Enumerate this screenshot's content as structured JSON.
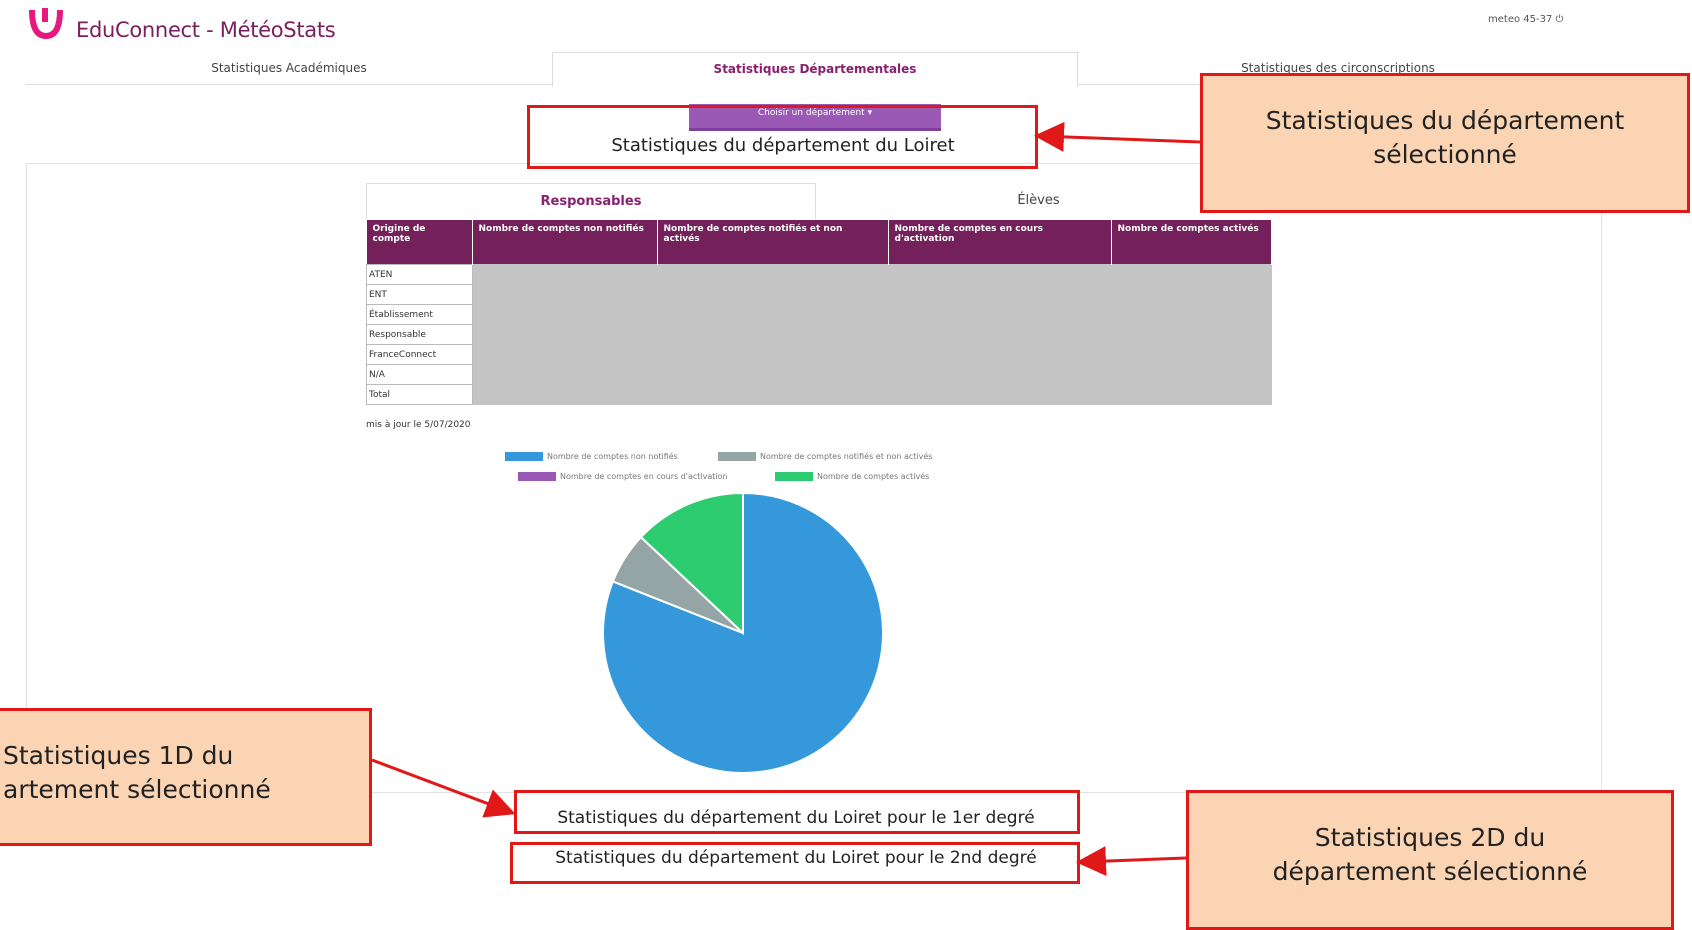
{
  "header": {
    "logo_icon": "educonnect-logo-icon",
    "app_title": "EduConnect - MétéoStats",
    "user_info": "meteo 45-37"
  },
  "tabs": [
    {
      "label": "Statistiques Académiques"
    },
    {
      "label": "Statistiques Départementales"
    },
    {
      "label": "Statistiques des circonscriptions"
    }
  ],
  "department": {
    "select_label": "Choisir un département",
    "title": "Statistiques du département du Loiret"
  },
  "subtabs": [
    {
      "label": "Responsables"
    },
    {
      "label": "Élèves"
    }
  ],
  "table": {
    "headers": [
      "Origine de compte",
      "Nombre de comptes non notifiés",
      "Nombre de comptes notifiés et non activés",
      "Nombre de comptes en cours d'activation",
      "Nombre de comptes activés"
    ],
    "rows": [
      "ATEN",
      "ENT",
      "Établissement",
      "Responsable",
      "FranceConnect",
      "N/A",
      "Total"
    ]
  },
  "updated_text": "mis à jour le 5/07/2020",
  "chart_data": {
    "type": "pie",
    "series": [
      {
        "name": "Nombre de comptes non notifiés",
        "value": 81,
        "color": "#3498db"
      },
      {
        "name": "Nombre de comptes notifiés et non activés",
        "value": 6,
        "color": "#95a5a6"
      },
      {
        "name": "Nombre de comptes en cours d'activation",
        "value": 0,
        "color": "#9b59b6"
      },
      {
        "name": "Nombre de comptes activés",
        "value": 13,
        "color": "#2ecc71"
      }
    ],
    "legend": "top"
  },
  "outputs": {
    "first_degree": "Statistiques du département du Loiret pour le 1er degré",
    "second_degree": "Statistiques du département du Loiret pour le 2nd degré"
  },
  "callouts": {
    "dept_line1": "Statistiques du département",
    "dept_line2": "sélectionné",
    "one_d_line1": "Statistiques 1D du",
    "one_d_line2": "artement sélectionné",
    "two_d_line1": "Statistiques 2D du",
    "two_d_line2": "département sélectionné"
  },
  "colors": {
    "brand": "#74205a",
    "accent": "#9b59b6",
    "annotation": "#e01818"
  }
}
